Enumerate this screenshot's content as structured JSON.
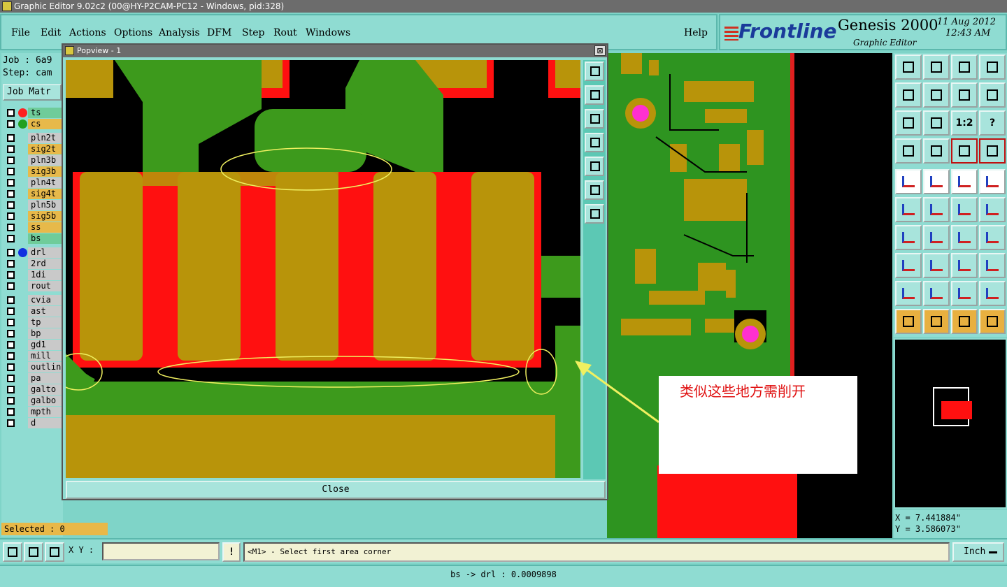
{
  "window": {
    "title": "Graphic Editor 9.02c2 (00@HY-P2CAM-PC12 - Windows, pid:328)"
  },
  "menu": {
    "items": [
      "File",
      "Edit",
      "Actions",
      "Options",
      "Analysis",
      "DFM",
      "Step",
      "Rout",
      "Windows"
    ],
    "help": "Help"
  },
  "brand": {
    "logo": "Frontline",
    "product": "Genesis 2000",
    "subtitle": "Graphic Editor",
    "date": "11 Aug 2012",
    "time": "12:43 AM"
  },
  "left": {
    "job": "Job : 6a9",
    "step": "Step: cam",
    "job_matrix": "Job Matr",
    "layers": [
      {
        "name": "ts",
        "style": "gr",
        "dot": "#ff2020"
      },
      {
        "name": "cs",
        "style": "sig",
        "dot": "#20a020"
      },
      {
        "name": "pln2t",
        "style": "",
        "dot": ""
      },
      {
        "name": "sig2t",
        "style": "sig",
        "dot": ""
      },
      {
        "name": "pln3b",
        "style": "",
        "dot": ""
      },
      {
        "name": "sig3b",
        "style": "sig",
        "dot": ""
      },
      {
        "name": "pln4t",
        "style": "",
        "dot": ""
      },
      {
        "name": "sig4t",
        "style": "sig",
        "dot": ""
      },
      {
        "name": "pln5b",
        "style": "",
        "dot": ""
      },
      {
        "name": "sig5b",
        "style": "sig",
        "dot": ""
      },
      {
        "name": "ss",
        "style": "sig",
        "dot": ""
      },
      {
        "name": "bs",
        "style": "gr",
        "dot": ""
      },
      {
        "name": "drl",
        "style": "",
        "dot": "#1030e0"
      },
      {
        "name": "2rd",
        "style": "",
        "dot": ""
      },
      {
        "name": "1di",
        "style": "",
        "dot": ""
      },
      {
        "name": "rout",
        "style": "",
        "dot": ""
      },
      {
        "name": "cvia",
        "style": "",
        "dot": ""
      },
      {
        "name": "ast",
        "style": "",
        "dot": ""
      },
      {
        "name": "tp",
        "style": "",
        "dot": ""
      },
      {
        "name": "bp",
        "style": "",
        "dot": ""
      },
      {
        "name": "gd1",
        "style": "",
        "dot": ""
      },
      {
        "name": "mill",
        "style": "",
        "dot": ""
      },
      {
        "name": "outline",
        "style": "",
        "dot": ""
      },
      {
        "name": "pa",
        "style": "",
        "dot": ""
      },
      {
        "name": "galto",
        "style": "",
        "dot": ""
      },
      {
        "name": "galbo",
        "style": "",
        "dot": ""
      },
      {
        "name": "mpth",
        "style": "",
        "dot": ""
      },
      {
        "name": "d",
        "style": "",
        "dot": ""
      }
    ],
    "selected": "Selected : 0"
  },
  "popview": {
    "title": "Popview - 1",
    "close_x": "⊠",
    "close_label": "Close"
  },
  "annotation": {
    "text": "类似这些地方需削开"
  },
  "coords": {
    "x": "X = 7.441884\"",
    "y": "Y = 3.586073\""
  },
  "status": {
    "xy_label": "X Y :",
    "xy_value": "",
    "bang": "!",
    "prompt": "<M1> - Select first area corner",
    "unit": "Inch",
    "info": "bs -> drl : 0.0009898"
  },
  "colors": {
    "copper_green": "#3d9a1c",
    "pad_gold": "#b8940a",
    "mask_red": "#ff1010",
    "highlight_yellow": "#e8e840",
    "panel_teal": "#8fdcd2"
  }
}
